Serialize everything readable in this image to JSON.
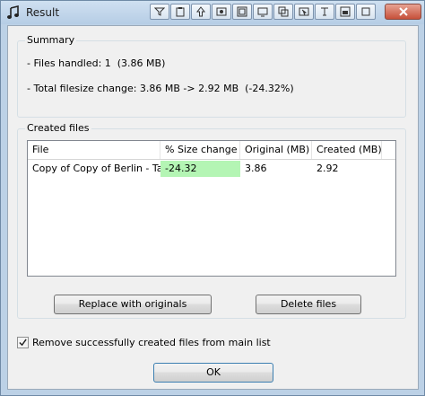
{
  "window": {
    "title": "Result"
  },
  "summary": {
    "legend": "Summary",
    "files_handled": "- Files handled: 1  (3.86 MB)",
    "filesize_change": "- Total filesize change: 3.86 MB -> 2.92 MB  (-24.32%)"
  },
  "created_files": {
    "legend": "Created files",
    "columns": [
      "File",
      "% Size change",
      "Original  (MB)",
      "Created  (MB)"
    ],
    "rows": [
      {
        "file": "Copy of Copy of Berlin - Ta...",
        "size_change": "-24.32",
        "original": "3.86",
        "created": "2.92"
      }
    ]
  },
  "buttons": {
    "replace": "Replace with originals",
    "delete": "Delete files",
    "ok": "OK"
  },
  "remove_checkbox": {
    "label": "Remove successfully created files from main list",
    "checked": true
  },
  "colors": {
    "highlight_green": "#b4f5b4",
    "title_bar": "#bcd1e6",
    "close_red": "#c7503a"
  }
}
